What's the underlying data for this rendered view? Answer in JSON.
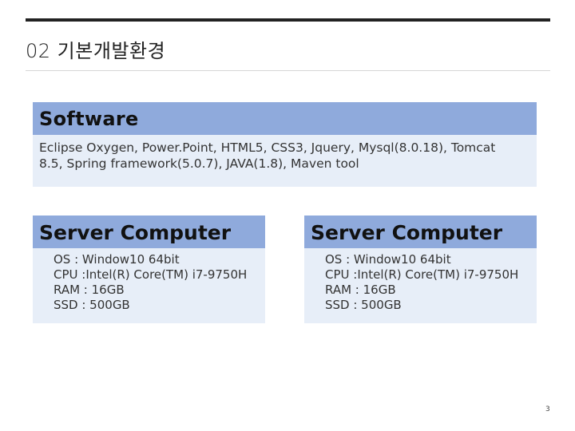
{
  "slide": {
    "title": "02 기본개발환경",
    "page_number": "3"
  },
  "software": {
    "heading": "Software",
    "lines": [
      "Eclipse Oxygen, Power.Point, HTML5, CSS3, Jquery, Mysql(8.0.18), Tomcat",
      "8.5, Spring framework(5.0.7), JAVA(1.8), Maven tool"
    ]
  },
  "servers": [
    {
      "heading": "Server Computer",
      "specs": [
        "OS : Window10 64bit",
        "CPU :Intel(R) Core(TM) i7-9750H",
        "RAM : 16GB",
        "SSD : 500GB"
      ]
    },
    {
      "heading": "Server Computer",
      "specs": [
        "OS : Window10 64bit",
        "CPU :Intel(R) Core(TM) i7-9750H",
        "RAM : 16GB",
        "SSD : 500GB"
      ]
    }
  ],
  "colors": {
    "header_fill": "#8faadc",
    "panel_fill": "#e7eef8",
    "rule": "#222222"
  }
}
